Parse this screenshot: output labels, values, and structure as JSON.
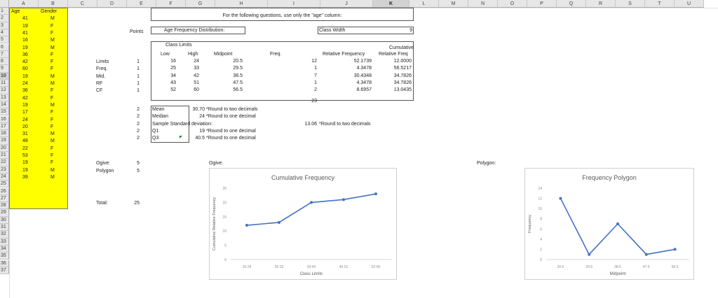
{
  "columns": [
    "A",
    "B",
    "C",
    "D",
    "E",
    "F",
    "G",
    "H",
    "I",
    "J",
    "K",
    "L",
    "M",
    "N",
    "O",
    "P",
    "Q",
    "R",
    "S",
    "T",
    "U"
  ],
  "rows": [
    "1",
    "2",
    "3",
    "4",
    "5",
    "6",
    "7",
    "8",
    "9",
    "10",
    "11",
    "12",
    "13",
    "14",
    "15",
    "16",
    "17",
    "18",
    "19",
    "20",
    "21",
    "22",
    "23",
    "24",
    "25",
    "26",
    "27",
    "28",
    "29",
    "30",
    "31",
    "32",
    "33",
    "34",
    "35",
    "36",
    "37"
  ],
  "selected_column": "K",
  "selected_row": "10",
  "header_age": "Age",
  "header_gender": "Gender",
  "ages": [
    "41",
    "19",
    "41",
    "16",
    "19",
    "36",
    "42",
    "60",
    "19",
    "24",
    "36",
    "42",
    "19",
    "17",
    "24",
    "20",
    "31",
    "48",
    "22",
    "53",
    "19",
    "19",
    "39"
  ],
  "genders": [
    "M",
    "F",
    "F",
    "M",
    "M",
    "F",
    "F",
    "F",
    "M",
    "M",
    "F",
    "F",
    "M",
    "F",
    "F",
    "F",
    "M",
    "M",
    "F",
    "F",
    "F",
    "M",
    "M"
  ],
  "instruction": "For the following questions, use only the \"age\" column:",
  "points_label": "Points",
  "afd_label": "Age Frequency Distribution:",
  "class_width_label": "Class Width",
  "class_width_value": "9",
  "class_limits_label": "Class Limits",
  "col_low": "Low",
  "col_high": "High",
  "col_midpoint": "Midpoint",
  "col_freq": "Freq.",
  "col_relfreq": "Relative Frequency",
  "col_cumrel_1": "Cumulative",
  "col_cumrel_2": "Relative Freq",
  "left_labels": [
    "Limits",
    "Freq.",
    "Mid.",
    "RF",
    "CF"
  ],
  "left_points": [
    "1",
    "1",
    "1",
    "1",
    "1"
  ],
  "table": [
    {
      "low": "16",
      "high": "24",
      "mid": "20.5",
      "freq": "12",
      "rf": "52.1739",
      "crf": "12.0000"
    },
    {
      "low": "25",
      "high": "33",
      "mid": "29.5",
      "freq": "1",
      "rf": "4.3478",
      "crf": "56.5217"
    },
    {
      "low": "34",
      "high": "42",
      "mid": "38.5",
      "freq": "7",
      "rf": "30.4348",
      "crf": "34.7826"
    },
    {
      "low": "43",
      "high": "51",
      "mid": "47.5",
      "freq": "1",
      "rf": "4.3478",
      "crf": "34.7826"
    },
    {
      "low": "52",
      "high": "60",
      "mid": "56.5",
      "freq": "2",
      "rf": "8.6957",
      "crf": "13.0435"
    }
  ],
  "freq_total": "23",
  "stats": [
    {
      "points": "2",
      "label": "Mean",
      "value": "30.70",
      "note": "*Round to two decimals"
    },
    {
      "points": "2",
      "label": "Median",
      "value": "24",
      "note": "*Round to one decimal"
    },
    {
      "points": "2",
      "label": "Sample Standard deviation:",
      "value": "",
      "note": ""
    },
    {
      "points": "2",
      "label": "Q1",
      "value": "19",
      "note": "*Round to one decimal"
    },
    {
      "points": "2",
      "label": "Q3",
      "value": "40.5",
      "note": "*Round to one decimal"
    }
  ],
  "sd_value": "13.06",
  "sd_note": "*Round to two decimals",
  "ogive_label": "Ogive:",
  "polygon_label": "Polygon",
  "ogive_points": "5",
  "polygon_points": "5",
  "ogive_cell_label": "Ogive:",
  "polygon_cell_label": "Polygon:",
  "total_label": "Total:",
  "total_value": "25",
  "chart_data": [
    {
      "type": "line",
      "title": "Cumulative Frequency",
      "xlabel": "Class Limits",
      "ylabel": "Cumulative Relative Frequency",
      "categories": [
        "16-24",
        "25-33",
        "34-42",
        "43-51",
        "52-60"
      ],
      "values": [
        12,
        13,
        20,
        21,
        23
      ],
      "ylim": [
        0,
        25
      ],
      "yticks": [
        "0",
        "5",
        "10",
        "15",
        "20",
        "25"
      ],
      "color": "#4472c4",
      "grid": false
    },
    {
      "type": "line",
      "title": "Frequency Polygon",
      "xlabel": "Midpoint",
      "ylabel": "Frequency",
      "categories": [
        "20.5",
        "29.5",
        "38.5",
        "47.5",
        "56.5"
      ],
      "values": [
        12,
        1,
        7,
        1,
        2
      ],
      "ylim": [
        0,
        14
      ],
      "yticks": [
        "0",
        "2",
        "4",
        "6",
        "8",
        "10",
        "12",
        "14"
      ],
      "color": "#4472c4",
      "grid": false
    }
  ]
}
